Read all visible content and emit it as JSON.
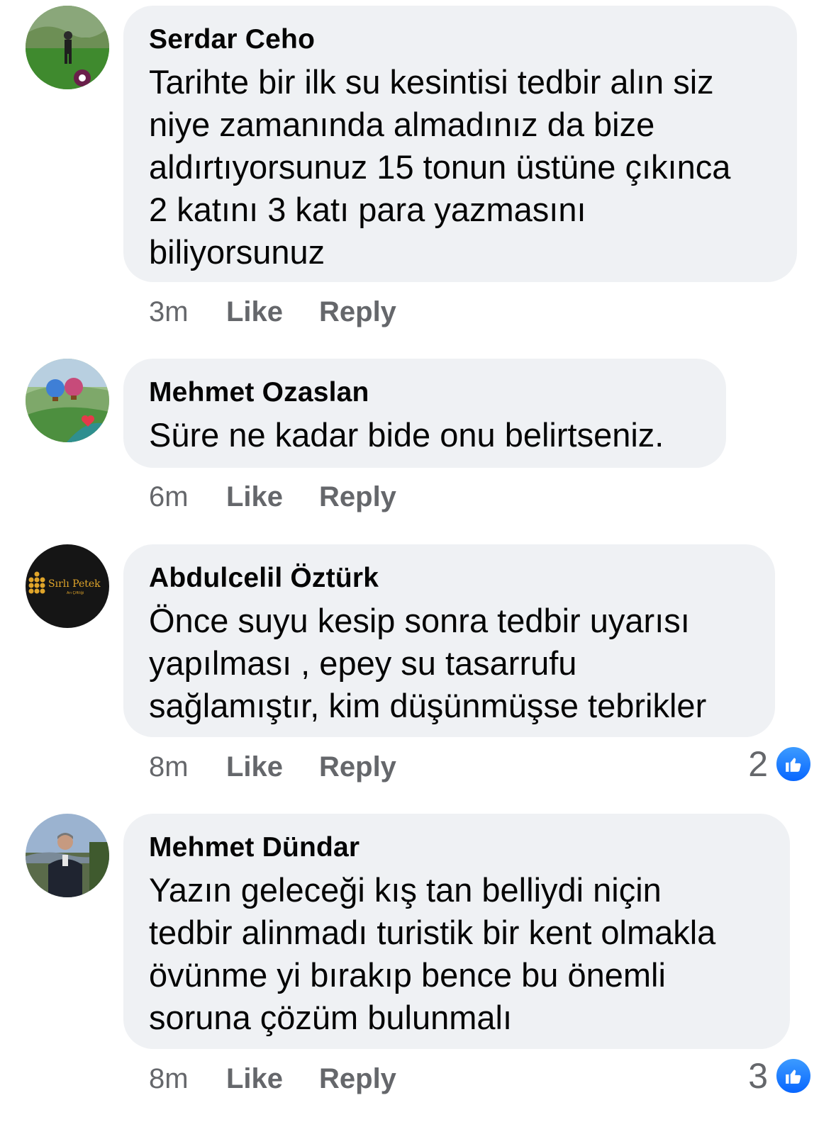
{
  "comments": [
    {
      "author": "Serdar Ceho",
      "text": "Tarihte bir ilk su kesintisi tedbir alın siz\nniye zamanında almadınız da bize\naldırtıyorsunuz 15 tonun üstüne çıkınca\n2 katını 3 katı para yazmasını\nbiliyorsunuz",
      "time": "3m",
      "like_label": "Like",
      "reply_label": "Reply",
      "avatar_icon": "person-avatar-icon"
    },
    {
      "author": "Mehmet Ozaslan",
      "text": "Süre ne kadar bide onu belirtseniz.",
      "time": "6m",
      "like_label": "Like",
      "reply_label": "Reply",
      "avatar_icon": "balloon-avatar-icon"
    },
    {
      "author": "Abdulcelil Öztürk",
      "text": "Önce suyu kesip sonra tedbir uyarısı\nyapılması , epey su tasarrufu\nsağlamıştır, kim düşünmüşse tebrikler",
      "time": "8m",
      "like_label": "Like",
      "reply_label": "Reply",
      "reaction_count": "2",
      "avatar_icon": "logo-avatar-icon",
      "avatar_logo_text": "Sırlı Petek"
    },
    {
      "author": "Mehmet Dündar",
      "text": "Yazın geleceği kış tan belliydi niçin\ntedbir alinmadı turistik bir kent olmakla\növünme yi bırakıp bence bu önemli\nsoruna çözüm bulunmalı",
      "time": "8m",
      "like_label": "Like",
      "reply_label": "Reply",
      "reaction_count": "3",
      "avatar_icon": "person-avatar-icon"
    }
  ],
  "colors": {
    "bubble": "#eff1f4",
    "meta_text": "#65676b",
    "like_blue": "#0866ff"
  }
}
